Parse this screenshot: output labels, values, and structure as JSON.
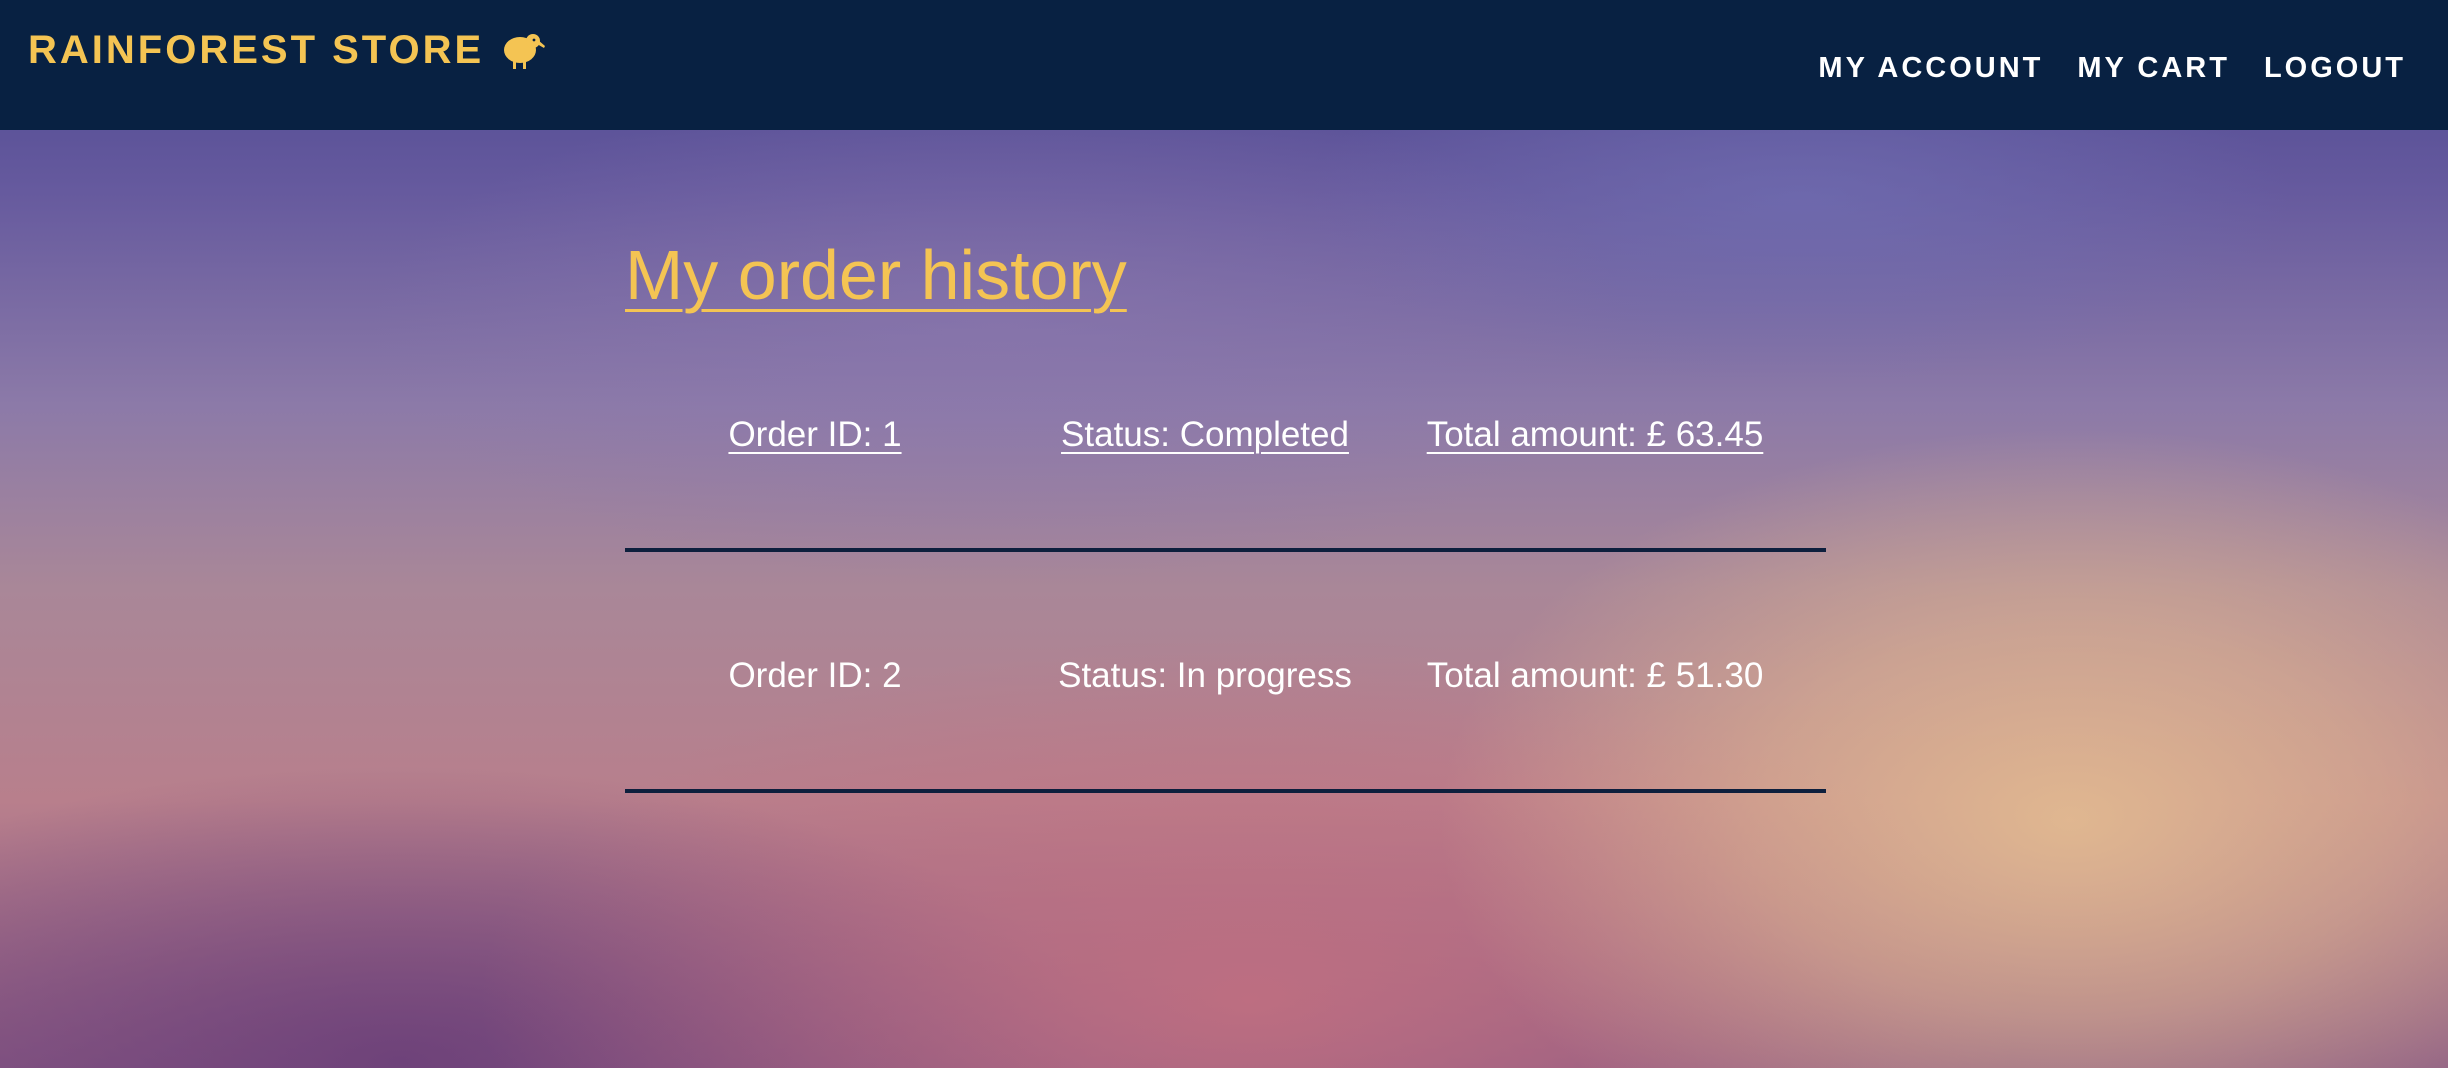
{
  "header": {
    "brand": "RAINFOREST STORE",
    "brand_icon": "kiwi-bird-icon",
    "nav": [
      {
        "label": "MY ACCOUNT"
      },
      {
        "label": "MY CART"
      },
      {
        "label": "LOGOUT"
      }
    ]
  },
  "main": {
    "title": "My order history",
    "orders": [
      {
        "id": "Order ID: 1",
        "status": "Status: Completed",
        "total": "Total amount: £ 63.45"
      },
      {
        "id": "Order ID: 2",
        "status": "Status: In progress",
        "total": "Total amount: £ 51.30"
      }
    ]
  },
  "colors": {
    "header_bg": "#082142",
    "accent": "#f4c453",
    "divider": "#0d1f3d",
    "text": "#ffffff"
  }
}
